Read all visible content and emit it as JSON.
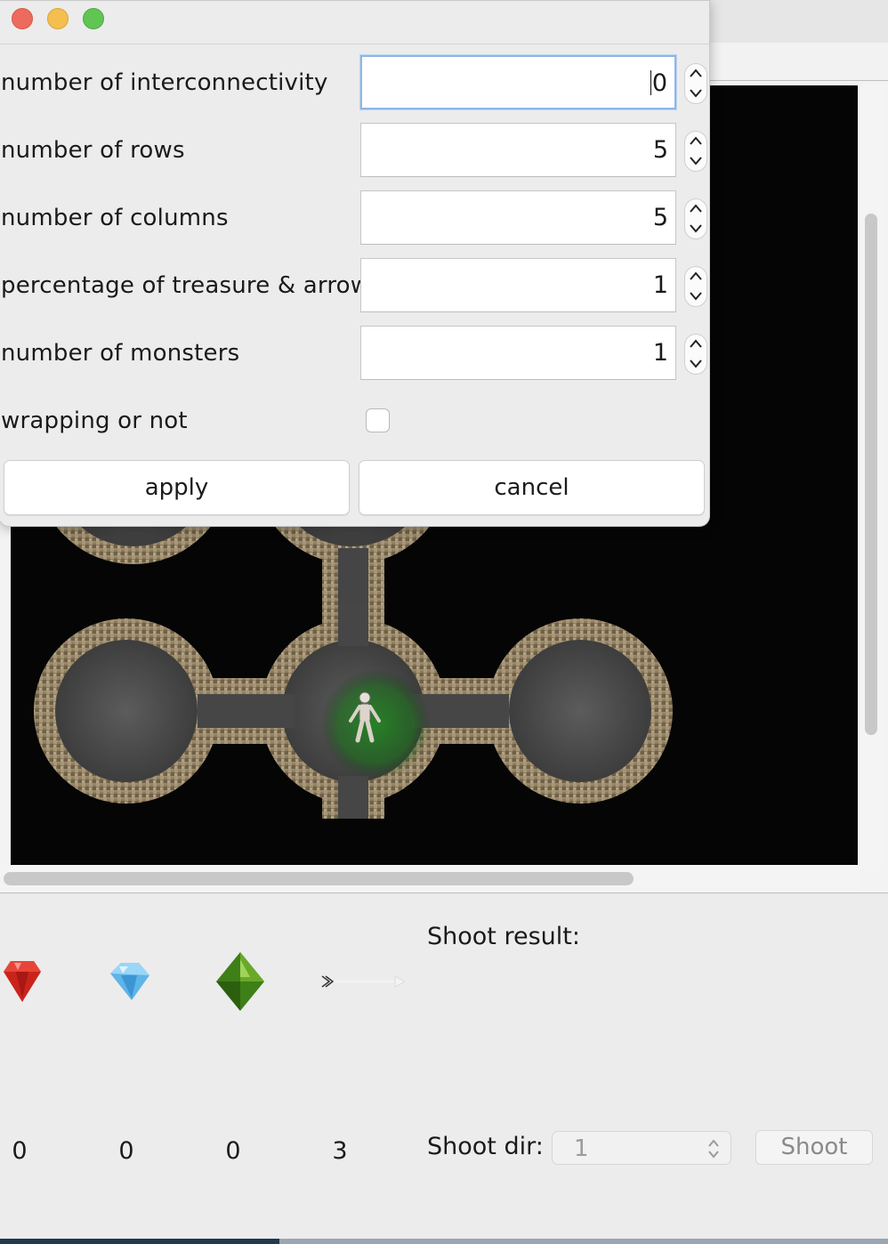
{
  "dialog": {
    "fields": [
      {
        "label": "number of interconnectivity",
        "value": "0"
      },
      {
        "label": "number of rows",
        "value": "5"
      },
      {
        "label": "number of columns",
        "value": "5"
      },
      {
        "label": "percentage of treasure & arrow",
        "value": "1"
      },
      {
        "label": "number of monsters",
        "value": "1"
      }
    ],
    "wrapping_label": "wrapping or not",
    "wrapping_checked": false,
    "apply_label": "apply",
    "cancel_label": "cancel"
  },
  "inventory": {
    "ruby_count": "0",
    "diamond_count": "0",
    "emerald_count": "0",
    "arrow_count": "3",
    "icons": [
      "ruby-icon",
      "diamond-icon",
      "emerald-icon",
      "arrow-icon"
    ]
  },
  "shoot": {
    "result_label": "Shoot result:",
    "result_text": "",
    "dir_label": "Shoot dir:",
    "dir_value": "1",
    "button_label": "Shoot"
  },
  "colors": {
    "close": "#ed6a5e",
    "minimize": "#f5bf4f",
    "maximize": "#61c554",
    "focus_ring": "#8fb5e6",
    "monster_smell": "#1f8a1f"
  }
}
